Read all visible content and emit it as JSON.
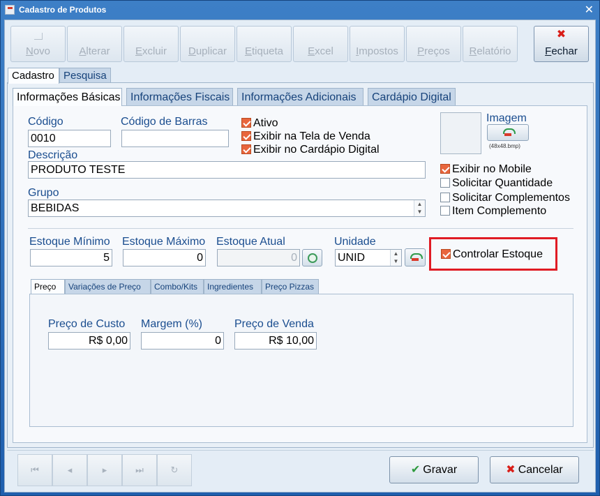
{
  "window": {
    "title": "Cadastro de Produtos",
    "close": "✕"
  },
  "toolbar": {
    "buttons": [
      {
        "label": "Novo"
      },
      {
        "label": "Alterar"
      },
      {
        "label": "Excluir"
      },
      {
        "label": "Duplicar"
      },
      {
        "label": "Etiqueta"
      },
      {
        "label": "Excel"
      },
      {
        "label": "Impostos"
      },
      {
        "label": "Preços"
      },
      {
        "label": "Relatório"
      }
    ],
    "close_label": "Fechar",
    "close_icon": "✖"
  },
  "tabs_top": [
    "Cadastro",
    "Pesquisa"
  ],
  "tabs_main": [
    "Informações Básicas",
    "Informações Fiscais",
    "Informações Adicionais",
    "Cardápio Digital"
  ],
  "fields": {
    "codigo": {
      "label": "Código",
      "value": "0010"
    },
    "codigo_barras": {
      "label": "Código de Barras",
      "value": ""
    },
    "descricao": {
      "label": "Descrição",
      "value": "PRODUTO TESTE"
    },
    "grupo": {
      "label": "Grupo",
      "value": "BEBIDAS"
    },
    "estoque_minimo": {
      "label": "Estoque Mínimo",
      "value": "5"
    },
    "estoque_maximo": {
      "label": "Estoque Máximo",
      "value": "0"
    },
    "estoque_atual": {
      "label": "Estoque Atual",
      "value": "0"
    },
    "unidade": {
      "label": "Unidade",
      "value": "UNID"
    }
  },
  "checkboxes": {
    "ativo": {
      "label": "Ativo",
      "checked": true
    },
    "exibir_tela_venda": {
      "label": "Exibir na Tela de Venda",
      "checked": true
    },
    "exibir_cardapio": {
      "label": "Exibir no Cardápio Digital",
      "checked": true
    },
    "exibir_mobile": {
      "label": "Exibir no Mobile",
      "checked": true
    },
    "solicitar_quantidade": {
      "label": "Solicitar Quantidade",
      "checked": false
    },
    "solicitar_complementos": {
      "label": "Solicitar Complementos",
      "checked": false
    },
    "item_complemento": {
      "label": "Item Complemento",
      "checked": false
    },
    "controlar_estoque": {
      "label": "Controlar Estoque",
      "checked": true
    }
  },
  "imagem": {
    "label": "Imagem",
    "hint": "(48x48.bmp)"
  },
  "tabs_preco": [
    "Preço",
    "Variações de Preço",
    "Combo/Kits",
    "Ingredientes",
    "Preço Pizzas"
  ],
  "preco": {
    "custo": {
      "label": "Preço de Custo",
      "value": "R$ 0,00"
    },
    "margem": {
      "label": "Margem (%)",
      "value": "0"
    },
    "venda": {
      "label": "Preço de Venda",
      "value": "R$ 10,00"
    }
  },
  "bottom": {
    "nav": [
      "⏮",
      "◂",
      "▸",
      "⏭",
      "↻"
    ],
    "gravar_label": "Gravar",
    "gravar_icon": "✔",
    "cancelar_label": "Cancelar",
    "cancelar_icon": "✖"
  },
  "colors": {
    "highlight": "#e01b24",
    "check": "#e8663d",
    "label": "#1a4d8f"
  }
}
